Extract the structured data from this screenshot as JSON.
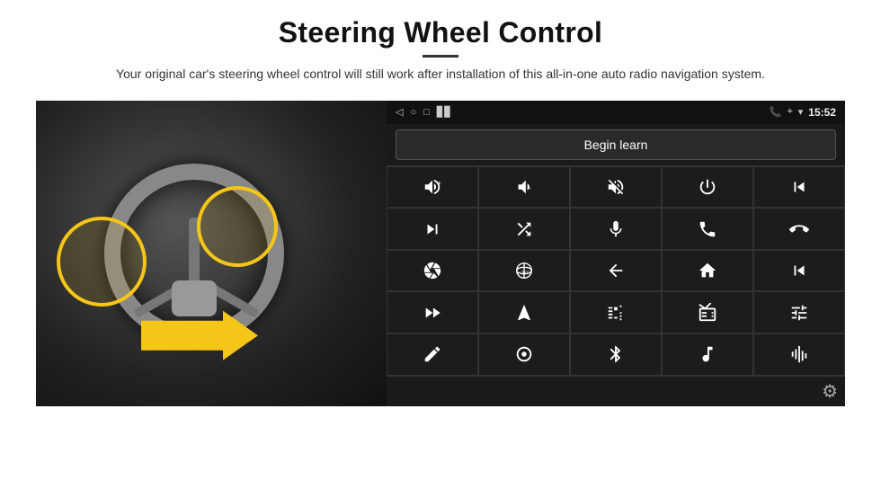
{
  "header": {
    "title": "Steering Wheel Control",
    "divider": true,
    "subtitle": "Your original car's steering wheel control will still work after installation of this all-in-one auto radio navigation system."
  },
  "android_screen": {
    "status_bar": {
      "back_icon": "◁",
      "circle_icon": "○",
      "square_icon": "□",
      "signal_icon": "▊▊",
      "phone_icon": "📞",
      "location_icon": "⌖",
      "wifi_icon": "▾",
      "time": "15:52"
    },
    "begin_learn_button": "Begin learn",
    "icons": [
      {
        "name": "vol-up",
        "unicode": "🔊+"
      },
      {
        "name": "vol-down",
        "unicode": "🔉−"
      },
      {
        "name": "vol-mute",
        "unicode": "🔇"
      },
      {
        "name": "power",
        "unicode": "⏻"
      },
      {
        "name": "prev-track",
        "unicode": "⏮"
      },
      {
        "name": "next-track",
        "unicode": "⏭"
      },
      {
        "name": "shuffle",
        "unicode": "⇌"
      },
      {
        "name": "mic",
        "unicode": "🎤"
      },
      {
        "name": "phone",
        "unicode": "📞"
      },
      {
        "name": "hang-up",
        "unicode": "📵"
      },
      {
        "name": "camera",
        "unicode": "📷"
      },
      {
        "name": "360-view",
        "unicode": "👁"
      },
      {
        "name": "back",
        "unicode": "↩"
      },
      {
        "name": "home",
        "unicode": "⌂"
      },
      {
        "name": "skip-back",
        "unicode": "⏮"
      },
      {
        "name": "fast-forward",
        "unicode": "⏭"
      },
      {
        "name": "nav",
        "unicode": "▲"
      },
      {
        "name": "eq",
        "unicode": "⇌"
      },
      {
        "name": "radio",
        "unicode": "📻"
      },
      {
        "name": "tune",
        "unicode": "🎚"
      },
      {
        "name": "pen",
        "unicode": "✏"
      },
      {
        "name": "radio-knob",
        "unicode": "🔘"
      },
      {
        "name": "bluetooth",
        "unicode": "✦"
      },
      {
        "name": "music",
        "unicode": "🎵"
      },
      {
        "name": "waveform",
        "unicode": "📊"
      }
    ]
  },
  "bottom": {
    "settings_icon": "⚙"
  }
}
